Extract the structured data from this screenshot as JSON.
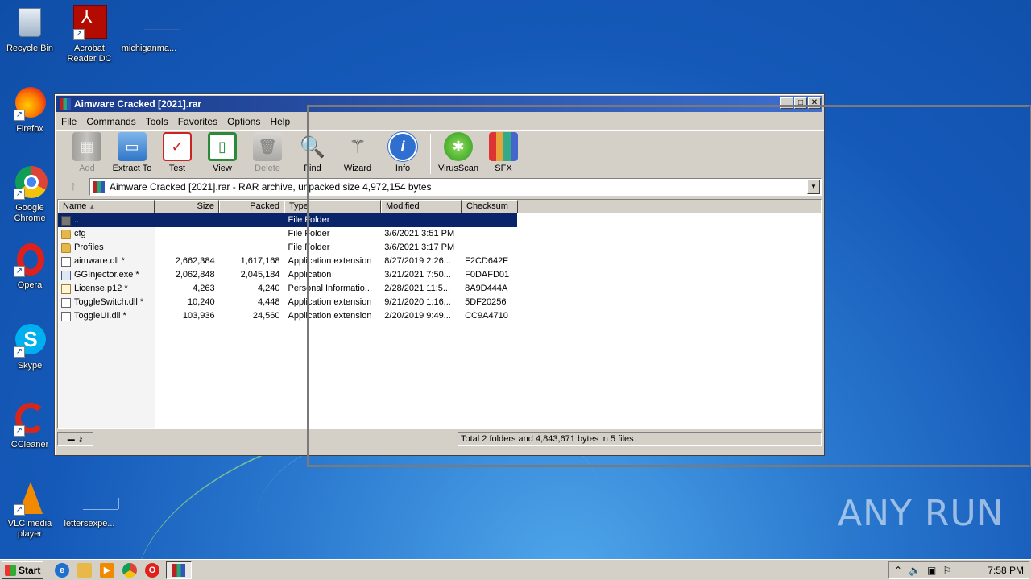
{
  "desktop": {
    "icons": [
      {
        "label": "Recycle Bin"
      },
      {
        "label": "Acrobat Reader DC"
      },
      {
        "label": "michiganma..."
      },
      {
        "label": "Firefox"
      },
      {
        "label": "Google Chrome"
      },
      {
        "label": "Opera"
      },
      {
        "label": "Skype"
      },
      {
        "label": "CCleaner"
      },
      {
        "label": "VLC media player"
      },
      {
        "label": "lettersexpe..."
      }
    ],
    "watermark": "ANY RUN"
  },
  "window": {
    "title": "Aimware Cracked [2021].rar",
    "buttons": {
      "minimize": "_",
      "maximize": "□",
      "close": "✕"
    },
    "menu": [
      "File",
      "Commands",
      "Tools",
      "Favorites",
      "Options",
      "Help"
    ],
    "toolbar": [
      {
        "label": "Add",
        "icon": "add-icon",
        "enabled": false
      },
      {
        "label": "Extract To",
        "icon": "extract-icon",
        "enabled": true
      },
      {
        "label": "Test",
        "icon": "test-icon",
        "enabled": true
      },
      {
        "label": "View",
        "icon": "view-icon",
        "enabled": true
      },
      {
        "label": "Delete",
        "icon": "delete-icon",
        "enabled": false
      },
      {
        "label": "Find",
        "icon": "find-icon",
        "enabled": true
      },
      {
        "label": "Wizard",
        "icon": "wizard-icon",
        "enabled": true
      },
      {
        "label": "Info",
        "icon": "info-icon",
        "enabled": true
      },
      {
        "label": "VirusScan",
        "icon": "virusscan-icon",
        "enabled": true
      },
      {
        "label": "SFX",
        "icon": "sfx-icon",
        "enabled": true
      }
    ],
    "address": "Aimware Cracked [2021].rar - RAR archive, unpacked size 4,972,154 bytes",
    "columns": [
      "Name",
      "Size",
      "Packed",
      "Type",
      "Modified",
      "Checksum"
    ],
    "rows": [
      {
        "name": "..",
        "size": "",
        "packed": "",
        "type": "File Folder",
        "modified": "",
        "checksum": "",
        "kind": "up"
      },
      {
        "name": "cfg",
        "size": "",
        "packed": "",
        "type": "File Folder",
        "modified": "3/6/2021 3:51 PM",
        "checksum": "",
        "kind": "folder"
      },
      {
        "name": "Profiles",
        "size": "",
        "packed": "",
        "type": "File Folder",
        "modified": "3/6/2021 3:17 PM",
        "checksum": "",
        "kind": "folder"
      },
      {
        "name": "aimware.dll *",
        "size": "2,662,384",
        "packed": "1,617,168",
        "type": "Application extension",
        "modified": "8/27/2019 2:26...",
        "checksum": "F2CD642F",
        "kind": "dll"
      },
      {
        "name": "GGInjector.exe *",
        "size": "2,062,848",
        "packed": "2,045,184",
        "type": "Application",
        "modified": "3/21/2021 7:50...",
        "checksum": "F0DAFD01",
        "kind": "exe"
      },
      {
        "name": "License.p12 *",
        "size": "4,263",
        "packed": "4,240",
        "type": "Personal Informatio...",
        "modified": "2/28/2021 11:5...",
        "checksum": "8A9D444A",
        "kind": "cert"
      },
      {
        "name": "ToggleSwitch.dll *",
        "size": "10,240",
        "packed": "4,448",
        "type": "Application extension",
        "modified": "9/21/2020 1:16...",
        "checksum": "5DF20256",
        "kind": "dll"
      },
      {
        "name": "ToggleUI.dll *",
        "size": "103,936",
        "packed": "24,560",
        "type": "Application extension",
        "modified": "2/20/2019 9:49...",
        "checksum": "CC9A4710",
        "kind": "dll"
      }
    ],
    "status": "Total 2 folders and 4,843,671 bytes in 5 files"
  },
  "taskbar": {
    "start": "Start",
    "clock": "7:58 PM"
  }
}
